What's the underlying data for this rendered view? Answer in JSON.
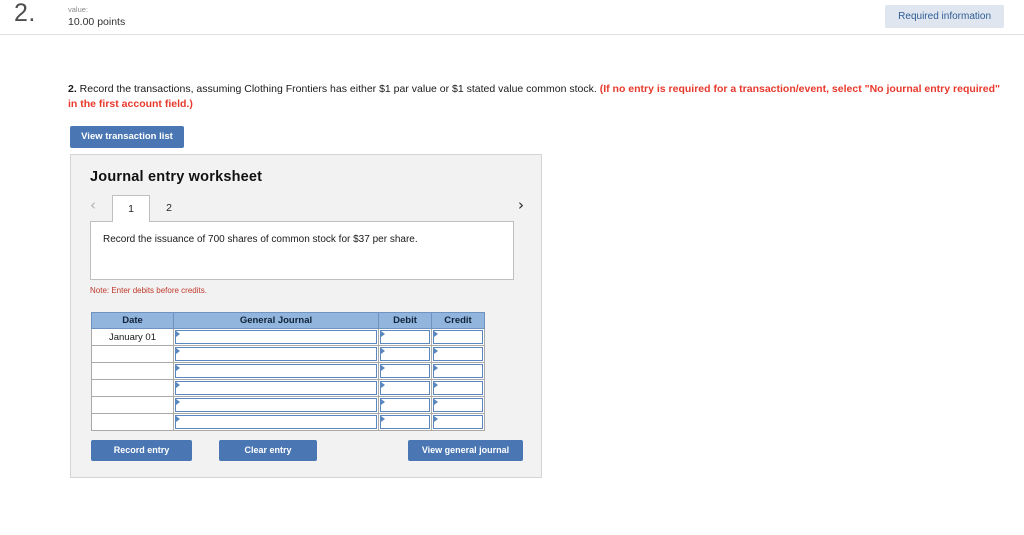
{
  "header": {
    "question_number": "2.",
    "value_label": "value:",
    "points": "10.00 points",
    "required_badge": "Required information"
  },
  "instruction": {
    "number": "2.",
    "main_text": " Record the transactions, assuming Clothing Frontiers has either $1 par value or $1 stated value common stock. ",
    "hint_text": "(If no entry is required for a transaction/event, select \"No journal entry required\" in the first account field.)"
  },
  "toolbar": {
    "view_transaction_list": "View transaction list"
  },
  "worksheet": {
    "title": "Journal entry worksheet",
    "prev_icon": "chevron-left-icon",
    "next_icon": "chevron-right-icon",
    "tabs": [
      {
        "label": "1",
        "active": true
      },
      {
        "label": "2",
        "active": false
      }
    ],
    "description": "Record the issuance of 700 shares of common stock for $37 per share.",
    "note": "Note: Enter debits before credits.",
    "table": {
      "headers": [
        "Date",
        "General Journal",
        "Debit",
        "Credit"
      ],
      "rows": [
        {
          "date": "January 01",
          "general_journal": "",
          "debit": "",
          "credit": ""
        },
        {
          "date": "",
          "general_journal": "",
          "debit": "",
          "credit": ""
        },
        {
          "date": "",
          "general_journal": "",
          "debit": "",
          "credit": ""
        },
        {
          "date": "",
          "general_journal": "",
          "debit": "",
          "credit": ""
        },
        {
          "date": "",
          "general_journal": "",
          "debit": "",
          "credit": ""
        },
        {
          "date": "",
          "general_journal": "",
          "debit": "",
          "credit": ""
        }
      ]
    },
    "buttons": {
      "record_entry": "Record entry",
      "clear_entry": "Clear entry",
      "view_general_journal": "View general journal"
    }
  },
  "colors": {
    "button_blue": "#4a77b4",
    "table_header_blue": "#92b5dd",
    "hint_red": "#e8392c",
    "note_red": "#c0392b",
    "panel_gray": "#f2f2f2",
    "badge_bg": "#dfe6ef",
    "badge_text": "#2f5d96"
  }
}
